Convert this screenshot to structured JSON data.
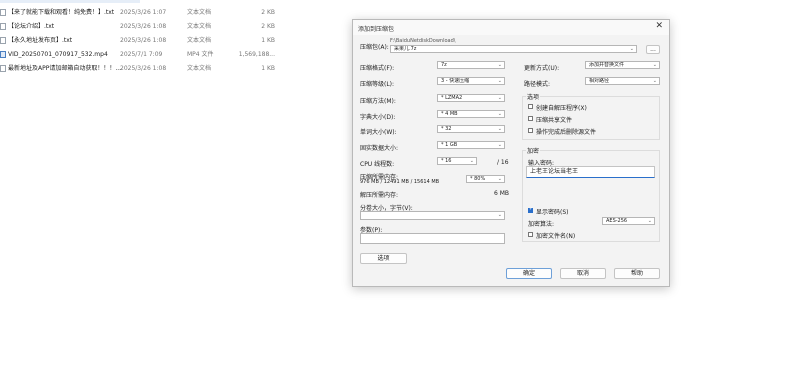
{
  "files": [
    {
      "name": "【来了就能下载和观看！纯免费！】.txt",
      "date": "2025/3/26 1:07",
      "type": "文本文档",
      "size": "2 KB"
    },
    {
      "name": "【论坛介绍】.txt",
      "date": "2025/3/26 1:08",
      "type": "文本文档",
      "size": "2 KB"
    },
    {
      "name": "【永久地址发布页】.txt",
      "date": "2025/3/26 1:08",
      "type": "文本文档",
      "size": "1 KB"
    },
    {
      "name": "VID_20250701_070917_532.mp4",
      "date": "2025/7/1 7:09",
      "type": "MP4 文件",
      "size": "1,569,188..."
    },
    {
      "name": "最新地址及APP请加邮箱自动获取！！！...",
      "date": "2025/3/26 1:08",
      "type": "文本文档",
      "size": "1 KB"
    }
  ],
  "dialog": {
    "title": "添加到压缩包",
    "close": "✕",
    "archive_label": "压缩包(A):",
    "archive_path": "F:\\BaiduNetdiskDownload\\",
    "archive_name": "采果儿.7z",
    "browse": "...",
    "format_label": "压缩格式(F):",
    "format_value": "7z",
    "level_label": "压缩等级(L):",
    "level_value": "3 - 快速压缩",
    "method_label": "压缩方法(M):",
    "method_value": "* LZMA2",
    "dict_label": "字典大小(D):",
    "dict_value": "* 4 MB",
    "word_label": "单词大小(W):",
    "word_value": "* 32",
    "solid_label": "固实数据大小:",
    "solid_value": "* 1 GB",
    "cpu_label": "CPU 线程数:",
    "cpu_value": "* 16",
    "cpu_total": "/ 16",
    "mem_label": "压缩所需内存:",
    "mem_detail": "976 MB / 12491 MB / 15614 MB",
    "mem_value": "* 80%",
    "decomp_label": "解压所需内存:",
    "decomp_value": "6 MB",
    "split_label": "分卷大小，字节(V):",
    "params_label": "参数(P):",
    "options_button": "选项",
    "update_label": "更新方式(U):",
    "update_value": "添加并替换文件",
    "path_label": "路径模式:",
    "path_value": "相对路径",
    "options_group": "选项",
    "opt_sfx": "创建自解压程序(X)",
    "opt_shared": "压缩共享文件",
    "opt_delete": "操作完成后删除源文件",
    "encrypt_group": "加密",
    "pwd_label": "输入密码:",
    "pwd_value": "上老王论坛当老王",
    "show_pwd": "显示密码(S)",
    "enc_method_label": "加密算法:",
    "enc_method_value": "AES-256",
    "enc_names": "加密文件名(N)",
    "ok": "确定",
    "cancel": "取消",
    "help": "帮助"
  }
}
